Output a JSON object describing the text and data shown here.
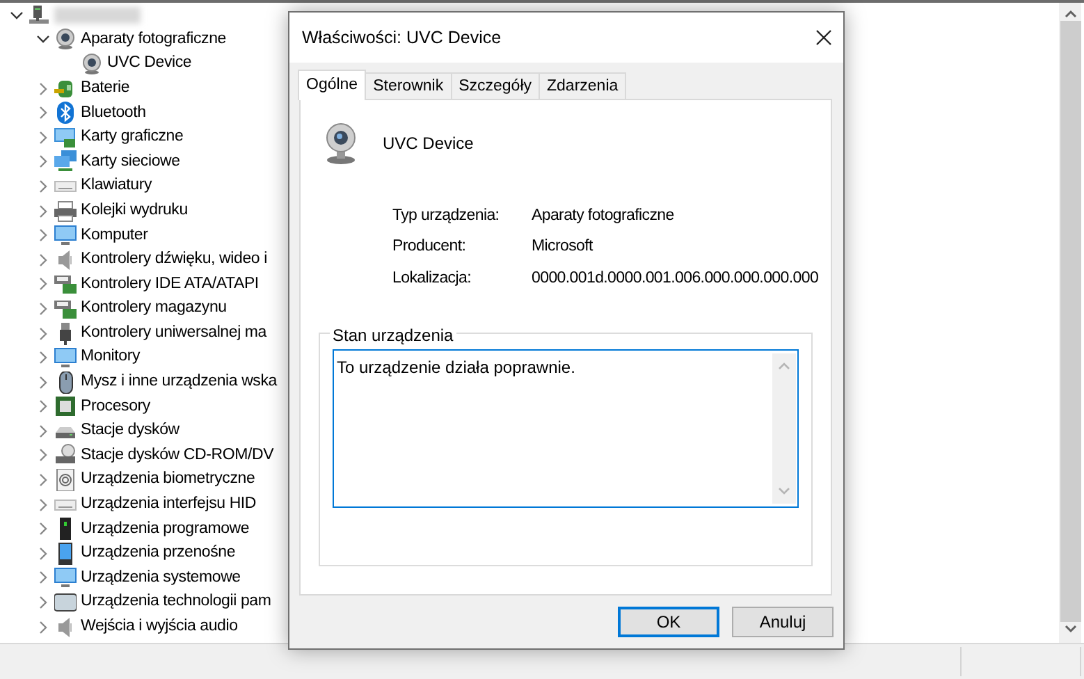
{
  "device_tree": {
    "root": {
      "kind": "computer",
      "expanded": true,
      "children": [
        {
          "label": "Aparaty fotograficzne",
          "kind": "camera",
          "expanded": true,
          "children": [
            {
              "label": "UVC Device",
              "kind": "camera"
            }
          ]
        },
        {
          "label": "Baterie",
          "kind": "battery",
          "expanded": false
        },
        {
          "label": "Bluetooth",
          "kind": "bluetooth",
          "expanded": false
        },
        {
          "label": "Karty graficzne",
          "kind": "display-card",
          "expanded": false
        },
        {
          "label": "Karty sieciowe",
          "kind": "network",
          "expanded": false
        },
        {
          "label": "Klawiatury",
          "kind": "keyboard",
          "expanded": false
        },
        {
          "label": "Kolejki wydruku",
          "kind": "printer",
          "expanded": false
        },
        {
          "label": "Komputer",
          "kind": "monitor",
          "expanded": false
        },
        {
          "label": "Kontrolery dźwięku, wideo i",
          "kind": "speaker",
          "expanded": false
        },
        {
          "label": "Kontrolery IDE ATA/ATAPI",
          "kind": "controller",
          "expanded": false
        },
        {
          "label": "Kontrolery magazynu",
          "kind": "controller",
          "expanded": false
        },
        {
          "label": "Kontrolery uniwersalnej ma",
          "kind": "usb",
          "expanded": false
        },
        {
          "label": "Monitory",
          "kind": "monitor",
          "expanded": false
        },
        {
          "label": "Mysz i inne urządzenia wska",
          "kind": "mouse",
          "expanded": false
        },
        {
          "label": "Procesory",
          "kind": "chip",
          "expanded": false
        },
        {
          "label": "Stacje dysków",
          "kind": "drive",
          "expanded": false
        },
        {
          "label": "Stacje dysków CD-ROM/DV",
          "kind": "disc",
          "expanded": false
        },
        {
          "label": "Urządzenia biometryczne",
          "kind": "fingerprint",
          "expanded": false
        },
        {
          "label": "Urządzenia interfejsu HID",
          "kind": "keyboard",
          "expanded": false
        },
        {
          "label": "Urządzenia programowe",
          "kind": "tower",
          "expanded": false
        },
        {
          "label": "Urządzenia przenośne",
          "kind": "tablet",
          "expanded": false
        },
        {
          "label": "Urządzenia systemowe",
          "kind": "monitor",
          "expanded": false
        },
        {
          "label": "Urządzenia technologii pam",
          "kind": "memory",
          "expanded": false
        },
        {
          "label": "Wejścia i wyjścia audio",
          "kind": "speaker",
          "expanded": false
        }
      ]
    }
  },
  "dialog": {
    "title": "Właściwości: UVC Device",
    "tabs": [
      {
        "label": "Ogólne",
        "selected": true
      },
      {
        "label": "Sterownik",
        "selected": false
      },
      {
        "label": "Szczegóły",
        "selected": false
      },
      {
        "label": "Zdarzenia",
        "selected": false
      }
    ],
    "device_name": "UVC Device",
    "properties": [
      {
        "label": "Typ urządzenia:",
        "value": "Aparaty fotograficzne"
      },
      {
        "label": "Producent:",
        "value": "Microsoft"
      },
      {
        "label": "Lokalizacja:",
        "value": "0000.001d.0000.001.006.000.000.000.000"
      }
    ],
    "status_group": {
      "title": "Stan urządzenia",
      "text": "To urządzenie działa poprawnie."
    },
    "buttons": [
      {
        "label": "OK",
        "default": true
      },
      {
        "label": "Anuluj",
        "default": false
      }
    ]
  }
}
